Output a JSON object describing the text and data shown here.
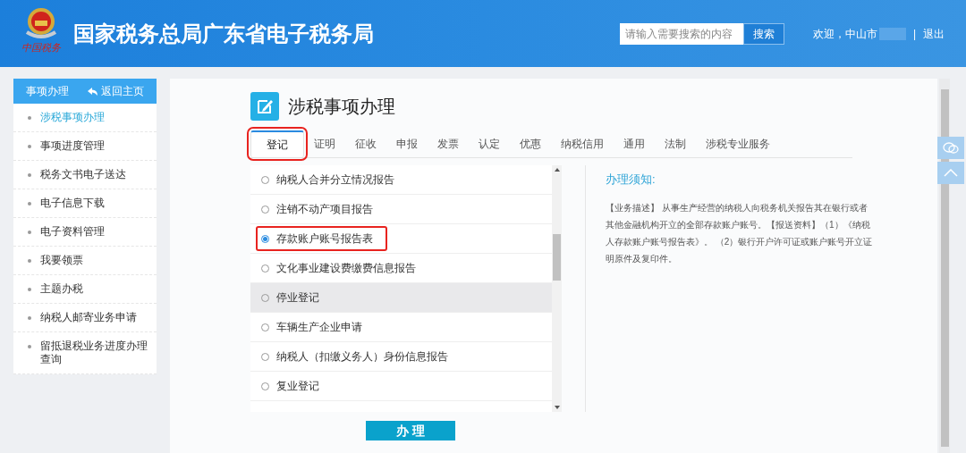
{
  "header": {
    "title": "国家税务总局广东省电子税务局",
    "logo_caption": "中国税务",
    "search": {
      "placeholder": "请输入需要搜索的内容",
      "button": "搜索"
    },
    "welcome": "欢迎，中山市",
    "separator": "|",
    "logout": "退出"
  },
  "sidebar": {
    "title": "事项办理",
    "back": "返回主页",
    "items": [
      {
        "label": "涉税事项办理",
        "selected": true
      },
      {
        "label": "事项进度管理",
        "selected": false
      },
      {
        "label": "税务文书电子送达",
        "selected": false
      },
      {
        "label": "电子信息下载",
        "selected": false
      },
      {
        "label": "电子资料管理",
        "selected": false
      },
      {
        "label": "我要领票",
        "selected": false
      },
      {
        "label": "主题办税",
        "selected": false
      },
      {
        "label": "纳税人邮寄业务申请",
        "selected": false
      },
      {
        "label": "留抵退税业务进度办理查询",
        "selected": false
      }
    ]
  },
  "page_title": "涉税事项办理",
  "tabs": [
    {
      "label": "登记",
      "selected": true,
      "highlighted": true
    },
    {
      "label": "证明",
      "selected": false,
      "highlighted": false
    },
    {
      "label": "征收",
      "selected": false,
      "highlighted": false
    },
    {
      "label": "申报",
      "selected": false,
      "highlighted": false
    },
    {
      "label": "发票",
      "selected": false,
      "highlighted": false
    },
    {
      "label": "认定",
      "selected": false,
      "highlighted": false
    },
    {
      "label": "优惠",
      "selected": false,
      "highlighted": false
    },
    {
      "label": "纳税信用",
      "selected": false,
      "highlighted": false
    },
    {
      "label": "通用",
      "selected": false,
      "highlighted": false
    },
    {
      "label": "法制",
      "selected": false,
      "highlighted": false
    },
    {
      "label": "涉税专业服务",
      "selected": false,
      "highlighted": false
    }
  ],
  "options": [
    {
      "label": "纳税人合并分立情况报告",
      "selected": false,
      "highlighted": false,
      "hovered": false
    },
    {
      "label": "注销不动产项目报告",
      "selected": false,
      "highlighted": false,
      "hovered": false
    },
    {
      "label": "存款账户账号报告表",
      "selected": true,
      "highlighted": true,
      "hovered": false
    },
    {
      "label": "文化事业建设费缴费信息报告",
      "selected": false,
      "highlighted": false,
      "hovered": false
    },
    {
      "label": "停业登记",
      "selected": false,
      "highlighted": false,
      "hovered": true
    },
    {
      "label": "车辆生产企业申请",
      "selected": false,
      "highlighted": false,
      "hovered": false
    },
    {
      "label": "纳税人（扣缴义务人）身份信息报告",
      "selected": false,
      "highlighted": false,
      "hovered": false
    },
    {
      "label": "复业登记",
      "selected": false,
      "highlighted": false,
      "hovered": false
    }
  ],
  "action_button": "办 理",
  "notice": {
    "title": "办理须知:",
    "body": "【业务描述】 从事生产经营的纳税人向税务机关报告其在银行或者其他金融机构开立的全部存款账户账号。【报送资料】（1）《纳税人存款账户账号报告表》。 （2）银行开户许可证或账户账号开立证明原件及复印件。"
  }
}
